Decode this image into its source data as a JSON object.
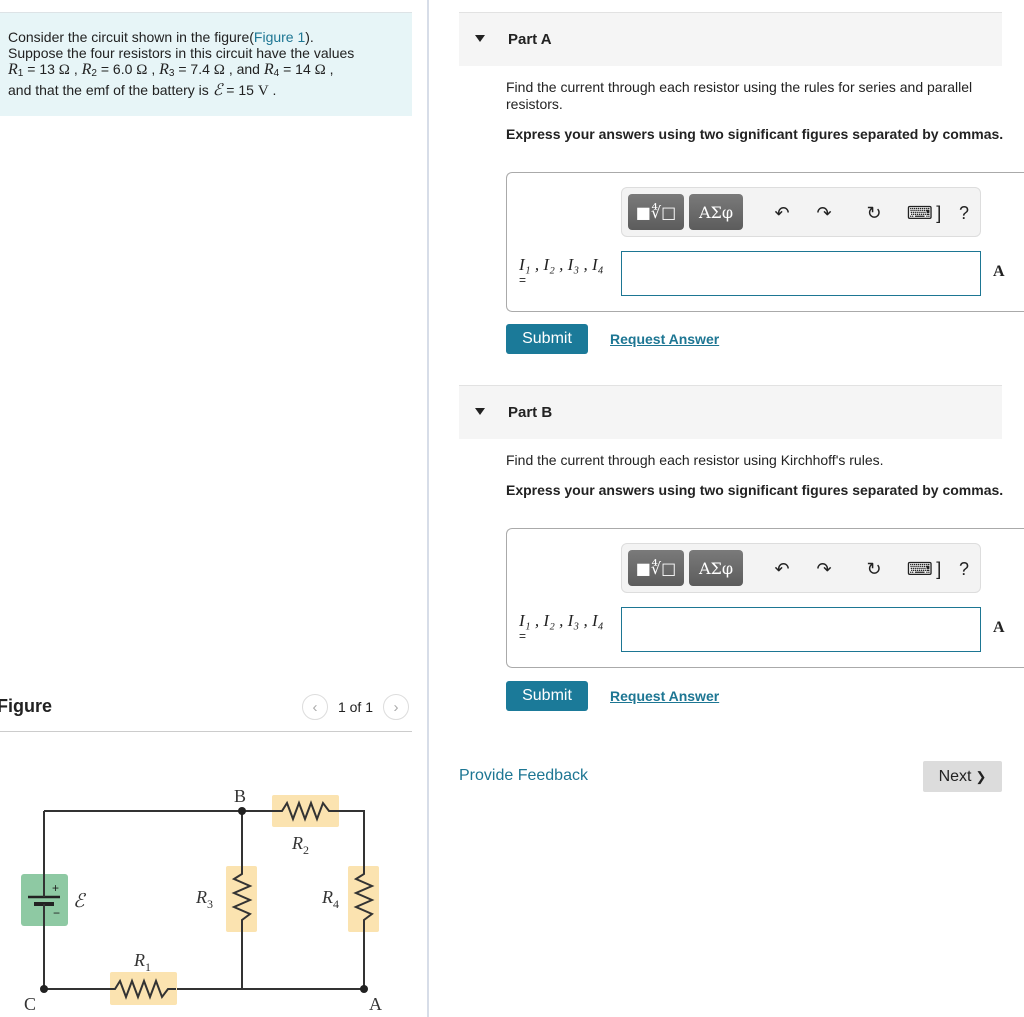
{
  "problem": {
    "lead": "Consider the circuit shown in the figure(",
    "figure_link": "Figure 1",
    "after_link": ").",
    "line2": "Suppose the four resistors in this circuit have the values",
    "resistors": [
      {
        "sym": "R",
        "sub": "1",
        "value": "13",
        "unit": "Ω"
      },
      {
        "sym": "R",
        "sub": "2",
        "value": "6.0",
        "unit": "Ω"
      },
      {
        "sym": "R",
        "sub": "3",
        "value": "7.4",
        "unit": "Ω"
      },
      {
        "sym": "R",
        "sub": "4",
        "value": "14",
        "unit": "Ω"
      }
    ],
    "and_word": "and",
    "line4_pre": "and that the emf of the battery is",
    "emf_symbol": "ℰ",
    "emf_value": "15",
    "emf_unit": "V"
  },
  "figure": {
    "title": "Figure",
    "pager_text": "1 of 1",
    "prev_icon": "chevron-left-icon",
    "next_icon": "chevron-right-icon",
    "circuit": {
      "nodes": [
        "A",
        "B",
        "C"
      ],
      "labels": {
        "R1": "R",
        "R1_sub": "1",
        "R2": "R",
        "R2_sub": "2",
        "R3": "R",
        "R3_sub": "3",
        "R4": "R",
        "R4_sub": "4",
        "emf": "ℰ",
        "plus": "+",
        "minus": "−"
      },
      "colors": {
        "resistor_bg": "#fbe3b0",
        "battery_bg": "#8ec9a3",
        "wire": "#333333"
      }
    }
  },
  "parts": [
    {
      "title": "Part A",
      "prompt": "Find the current through each resistor using the rules for series and parallel resistors.",
      "instructions": "Express your answers using two significant figures separated by commas.",
      "variable_label": "I₁ , I₂ , I₃ , I₄",
      "equals": "=",
      "input_value": "",
      "unit": "A",
      "submit_label": "Submit",
      "request_label": "Request Answer"
    },
    {
      "title": "Part B",
      "prompt": "Find the current through each resistor using Kirchhoff's rules.",
      "instructions": "Express your answers using two significant figures separated by commas.",
      "variable_label": "I₁ , I₂ , I₃ , I₄",
      "equals": "=",
      "input_value": "",
      "unit": "A",
      "submit_label": "Submit",
      "request_label": "Request Answer"
    }
  ],
  "toolbar": {
    "templates_icon": "■∜□",
    "symbols_label": "ΑΣφ",
    "undo_icon": "↶",
    "redo_icon": "↷",
    "reset_icon": "↻",
    "keyboard_icon": "⌨",
    "help_label": "?"
  },
  "footer": {
    "feedback_label": "Provide Feedback",
    "next_label": "Next",
    "next_icon": "❯"
  },
  "colors": {
    "accent": "#1b7a99",
    "link": "#1d7693",
    "intro_bg": "#e7f5f7"
  }
}
